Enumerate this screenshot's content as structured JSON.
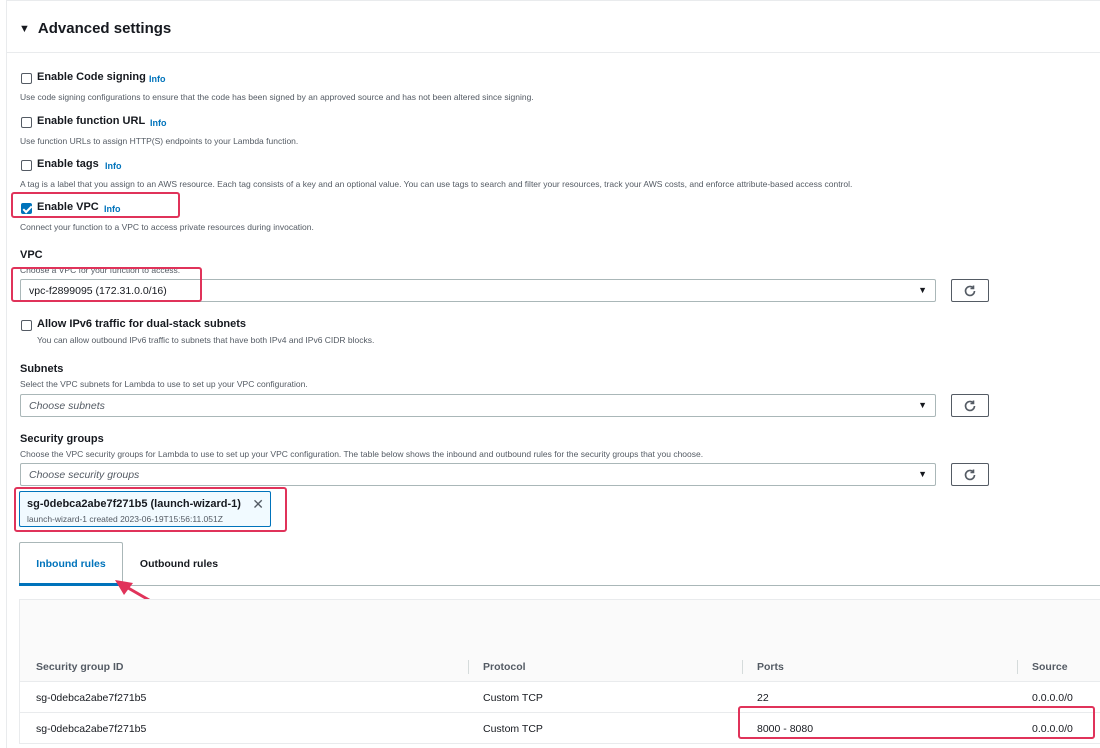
{
  "section": {
    "title": "Advanced settings"
  },
  "options": {
    "code_signing": {
      "label": "Enable Code signing",
      "info": "Info",
      "desc": "Use code signing configurations to ensure that the code has been signed by an approved source and has not been altered since signing."
    },
    "function_url": {
      "label": "Enable function URL",
      "info": "Info",
      "desc": "Use function URLs to assign HTTP(S) endpoints to your Lambda function."
    },
    "tags": {
      "label": "Enable tags",
      "info": "Info",
      "desc": "A tag is a label that you assign to an AWS resource. Each tag consists of a key and an optional value. You can use tags to search and filter your resources, track your AWS costs, and enforce attribute-based access control."
    },
    "vpc": {
      "label": "Enable VPC",
      "info": "Info",
      "desc": "Connect your function to a VPC to access private resources during invocation."
    }
  },
  "vpc_field": {
    "label": "VPC",
    "desc": "Choose a VPC for your function to access.",
    "value": "vpc-f2899095 (172.31.0.0/16)"
  },
  "ipv6": {
    "label": "Allow IPv6 traffic for dual-stack subnets",
    "desc": "You can allow outbound IPv6 traffic to subnets that have both IPv4 and IPv6 CIDR blocks."
  },
  "subnets": {
    "label": "Subnets",
    "desc": "Select the VPC subnets for Lambda to use to set up your VPC configuration.",
    "placeholder": "Choose subnets"
  },
  "security_groups": {
    "label": "Security groups",
    "desc": "Choose the VPC security groups for Lambda to use to set up your VPC configuration. The table below shows the inbound and outbound rules for the security groups that you choose.",
    "placeholder": "Choose security groups",
    "token": {
      "title": "sg-0debca2abe7f271b5 (launch-wizard-1)",
      "subtitle": "launch-wizard-1 created 2023-06-19T15:56:11.051Z"
    }
  },
  "tabs": [
    {
      "label": "Inbound rules"
    },
    {
      "label": "Outbound rules"
    }
  ],
  "rules_table": {
    "columns": [
      "Security group ID",
      "Protocol",
      "Ports",
      "Source"
    ],
    "rows": [
      [
        "sg-0debca2abe7f271b5",
        "Custom TCP",
        "22",
        "0.0.0.0/0"
      ],
      [
        "sg-0debca2abe7f271b5",
        "Custom TCP",
        "8000 - 8080",
        "0.0.0.0/0"
      ]
    ]
  },
  "colors": {
    "accent": "#0073bb",
    "highlight": "#e0335a",
    "text": "#16191f",
    "muted": "#545b64"
  }
}
